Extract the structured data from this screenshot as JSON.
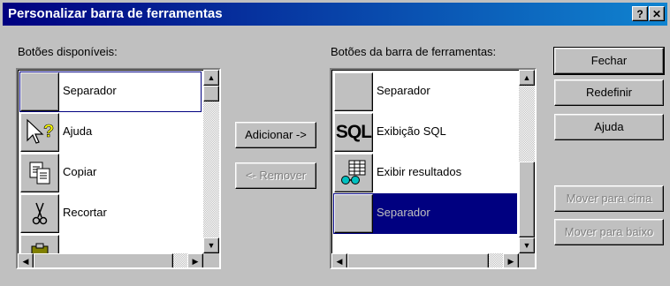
{
  "dialog": {
    "title": "Personalizar barra de ferramentas",
    "help_glyph": "?",
    "close_glyph": "✕"
  },
  "left": {
    "label": "Botões disponíveis:",
    "items": [
      {
        "label": "Separador",
        "icon": "blank"
      },
      {
        "label": "Ajuda",
        "icon": "help-arrow-icon"
      },
      {
        "label": "Copiar",
        "icon": "copy-icon"
      },
      {
        "label": "Recortar",
        "icon": "scissors-icon"
      },
      {
        "label": "",
        "icon": "paste-icon"
      }
    ]
  },
  "right": {
    "label": "Botões da barra de ferramentas:",
    "items": [
      {
        "label": "Separador",
        "icon": "blank"
      },
      {
        "label": "Exibição SQL",
        "icon": "sql-icon",
        "icon_text": "SQL"
      },
      {
        "label": "Exibir resultados",
        "icon": "results-grid-icon"
      },
      {
        "label": "Separador",
        "icon": "blank",
        "selected": true
      }
    ]
  },
  "buttons": {
    "add": "Adicionar ->",
    "remove": "<- Remover",
    "close": "Fechar",
    "reset": "Redefinir",
    "help": "Ajuda",
    "move_up": "Mover para cima",
    "move_down": "Mover para baixo"
  },
  "scroll_glyphs": {
    "up": "▲",
    "down": "▼",
    "left": "◀",
    "right": "▶"
  },
  "colors": {
    "title_bar": "#000080",
    "selection": "#000080",
    "face": "#c0c0c0"
  }
}
